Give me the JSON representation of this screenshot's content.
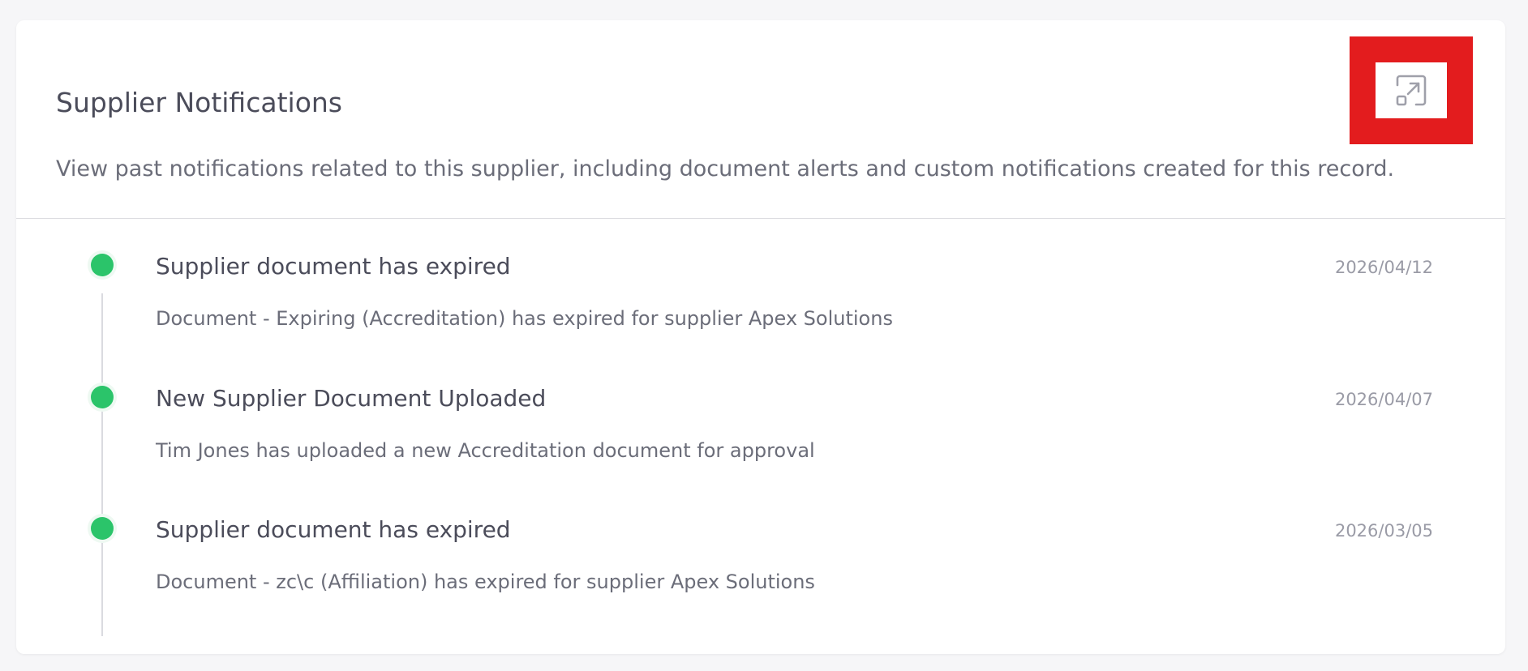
{
  "panel": {
    "title": "Supplier Notifications",
    "description": "View past notifications related to this supplier, including document alerts and custom notifications created for this record.",
    "expand_icon": "open-in-new-window-icon",
    "highlight_color": "#e31c1e"
  },
  "notifications": [
    {
      "title": "Supplier document has expired",
      "date": "2026/04/12",
      "body": "Document - Expiring (Accreditation) has expired for supplier Apex Solutions",
      "status_color": "#2bc46a"
    },
    {
      "title": "New Supplier Document Uploaded",
      "date": "2026/04/07",
      "body": "Tim Jones has uploaded a new Accreditation document for approval",
      "status_color": "#2bc46a"
    },
    {
      "title": "Supplier document has expired",
      "date": "2026/03/05",
      "body": "Document - zc\\c (Affiliation) has expired for supplier Apex Solutions",
      "status_color": "#2bc46a"
    }
  ]
}
